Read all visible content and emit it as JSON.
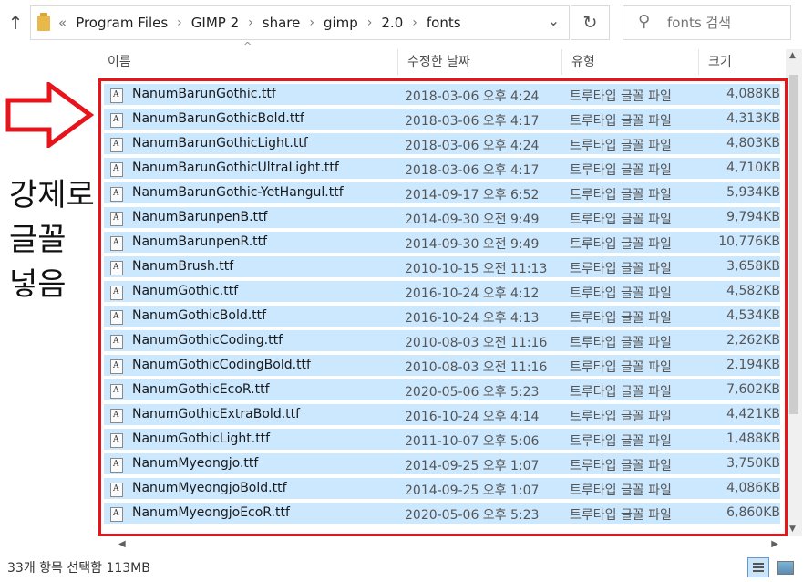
{
  "address_bar": {
    "breadcrumbs": [
      "Program Files",
      "GIMP 2",
      "share",
      "gimp",
      "2.0",
      "fonts"
    ],
    "overflow_glyph": "«",
    "search_placeholder": "fonts 검색"
  },
  "columns": {
    "name": "이름",
    "date": "수정한 날짜",
    "type": "유형",
    "size": "크기"
  },
  "files": [
    {
      "name": "NanumBarunGothic.ttf",
      "date": "2018-03-06 오후 4:24",
      "type": "트루타입 글꼴 파일",
      "size": "4,088KB"
    },
    {
      "name": "NanumBarunGothicBold.ttf",
      "date": "2018-03-06 오후 4:17",
      "type": "트루타입 글꼴 파일",
      "size": "4,313KB"
    },
    {
      "name": "NanumBarunGothicLight.ttf",
      "date": "2018-03-06 오후 4:24",
      "type": "트루타입 글꼴 파일",
      "size": "4,803KB"
    },
    {
      "name": "NanumBarunGothicUltraLight.ttf",
      "date": "2018-03-06 오후 4:17",
      "type": "트루타입 글꼴 파일",
      "size": "4,710KB"
    },
    {
      "name": "NanumBarunGothic-YetHangul.ttf",
      "date": "2014-09-17 오후 6:52",
      "type": "트루타입 글꼴 파일",
      "size": "5,934KB"
    },
    {
      "name": "NanumBarunpenB.ttf",
      "date": "2014-09-30 오전 9:49",
      "type": "트루타입 글꼴 파일",
      "size": "9,794KB"
    },
    {
      "name": "NanumBarunpenR.ttf",
      "date": "2014-09-30 오전 9:49",
      "type": "트루타입 글꼴 파일",
      "size": "10,776KB"
    },
    {
      "name": "NanumBrush.ttf",
      "date": "2010-10-15 오전 11:13",
      "type": "트루타입 글꼴 파일",
      "size": "3,658KB"
    },
    {
      "name": "NanumGothic.ttf",
      "date": "2016-10-24 오후 4:12",
      "type": "트루타입 글꼴 파일",
      "size": "4,582KB"
    },
    {
      "name": "NanumGothicBold.ttf",
      "date": "2016-10-24 오후 4:13",
      "type": "트루타입 글꼴 파일",
      "size": "4,534KB"
    },
    {
      "name": "NanumGothicCoding.ttf",
      "date": "2010-08-03 오전 11:16",
      "type": "트루타입 글꼴 파일",
      "size": "2,262KB"
    },
    {
      "name": "NanumGothicCodingBold.ttf",
      "date": "2010-08-03 오전 11:16",
      "type": "트루타입 글꼴 파일",
      "size": "2,194KB"
    },
    {
      "name": "NanumGothicEcoR.ttf",
      "date": "2020-05-06 오후 5:23",
      "type": "트루타입 글꼴 파일",
      "size": "7,602KB"
    },
    {
      "name": "NanumGothicExtraBold.ttf",
      "date": "2016-10-24 오후 4:14",
      "type": "트루타입 글꼴 파일",
      "size": "4,421KB"
    },
    {
      "name": "NanumGothicLight.ttf",
      "date": "2011-10-07 오후 5:06",
      "type": "트루타입 글꼴 파일",
      "size": "1,488KB"
    },
    {
      "name": "NanumMyeongjo.ttf",
      "date": "2014-09-25 오후 1:07",
      "type": "트루타입 글꼴 파일",
      "size": "3,750KB"
    },
    {
      "name": "NanumMyeongjoBold.ttf",
      "date": "2014-09-25 오후 1:07",
      "type": "트루타입 글꼴 파일",
      "size": "4,086KB"
    },
    {
      "name": "NanumMyeongjoEcoR.ttf",
      "date": "2020-05-06 오후 5:23",
      "type": "트루타입 글꼴 파일",
      "size": "6,860KB"
    }
  ],
  "annotation": {
    "lines": [
      "강제로",
      "글꼴",
      "넣음"
    ],
    "color": "#e8141c"
  },
  "status_bar": {
    "text": "33개 항목 선택함 113MB"
  },
  "colors": {
    "selection": "#cce8ff",
    "highlight_border": "#e8141c"
  }
}
